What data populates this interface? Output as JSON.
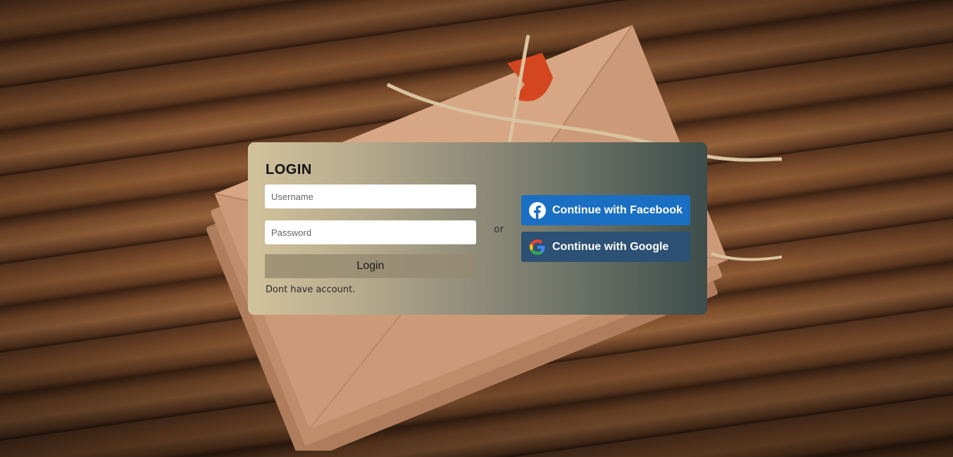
{
  "login": {
    "title": "LOGIN",
    "username_placeholder": "Username",
    "username_value": "",
    "password_placeholder": "Password",
    "password_value": "",
    "login_button": "Login",
    "signup_text": "Dont have account."
  },
  "divider": {
    "text": "or"
  },
  "social": {
    "facebook_label": "Continue with Facebook",
    "facebook_icon": "facebook-icon",
    "facebook_color": "#1a6fc2",
    "google_label": "Continue with Google",
    "google_icon": "google-icon",
    "google_color": "#2d5174"
  },
  "colors": {
    "card_gradient_start": "#d2c29b",
    "card_gradient_end": "#3d4d4b",
    "login_button_bg": "#9a8d74"
  }
}
